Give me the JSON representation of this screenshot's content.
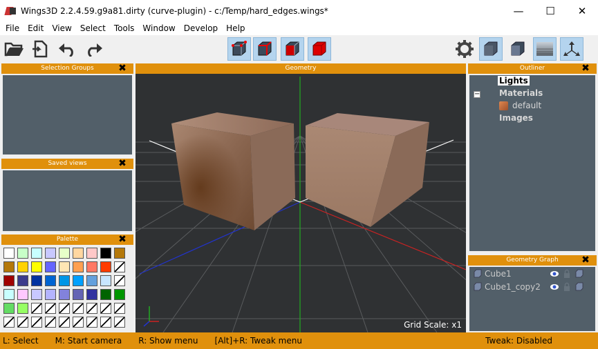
{
  "window": {
    "title": "Wings3D 2.2.4.59.g9a81.dirty (curve-plugin) - c:/Temp/hard_edges.wings*",
    "minimize": "—",
    "maximize": "☐",
    "close": "✕"
  },
  "menu": [
    "File",
    "Edit",
    "View",
    "Select",
    "Tools",
    "Window",
    "Develop",
    "Help"
  ],
  "toolbar": {
    "left": [
      "open-folder-icon",
      "import-icon",
      "undo-icon",
      "redo-icon"
    ],
    "selection_modes": [
      "vertex-mode-icon",
      "edge-mode-icon",
      "face-mode-icon",
      "body-mode-icon"
    ],
    "right": [
      "settings-gear-icon",
      "smooth-shading-icon",
      "flat-shading-icon",
      "ground-grid-icon",
      "axes-icon"
    ]
  },
  "panels": {
    "selection_groups": "Selection Groups",
    "saved_views": "Saved views",
    "palette": "Palette",
    "geometry": "Geometry",
    "outliner": "Outliner",
    "geometry_graph": "Geometry Graph",
    "close_glyph": "✖"
  },
  "palette": {
    "rows": [
      [
        "#ffffff",
        "#c8ffc8",
        "#c8ffff",
        "#c8c8ff",
        "#e6ffc8",
        "#ffd7a0",
        "#ffc8c8",
        "#000000",
        "#b4780a"
      ],
      [
        "#b4780a",
        "#ffd200",
        "#ffff00",
        "#6464ff",
        "#ffe6b4",
        "#ffa050",
        "#ff7864",
        "#ff3c00",
        null
      ],
      [
        "#a00000",
        "#3c3c8c",
        "#0032a0",
        "#0064d2",
        "#0096e6",
        "#00a0ff",
        "#64a0dc",
        "#c8e6ff",
        null
      ],
      [
        "#c8ffff",
        "#ffc8ff",
        "#c8c8ff",
        "#b4b4ff",
        "#8282dc",
        "#6464b4",
        "#3232a0",
        "#006400",
        "#009600"
      ],
      [
        "#64dc64",
        "#96ff64",
        null,
        null,
        null,
        null,
        null,
        null,
        null
      ],
      [
        null,
        null,
        null,
        null,
        null,
        null,
        null,
        null,
        null
      ]
    ]
  },
  "viewport": {
    "grid_scale": "Grid Scale: x1"
  },
  "outliner": {
    "lights": "Lights",
    "materials": "Materials",
    "default": "default",
    "images": "Images",
    "collapse": "−"
  },
  "geometry_graph": {
    "objects": [
      "Cube1",
      "Cube1_copy2"
    ]
  },
  "status": {
    "left": [
      "L: Select",
      "M: Start camera",
      "R: Show menu",
      "[Alt]+R: Tweak menu"
    ],
    "tweak": "Tweak: Disabled"
  }
}
